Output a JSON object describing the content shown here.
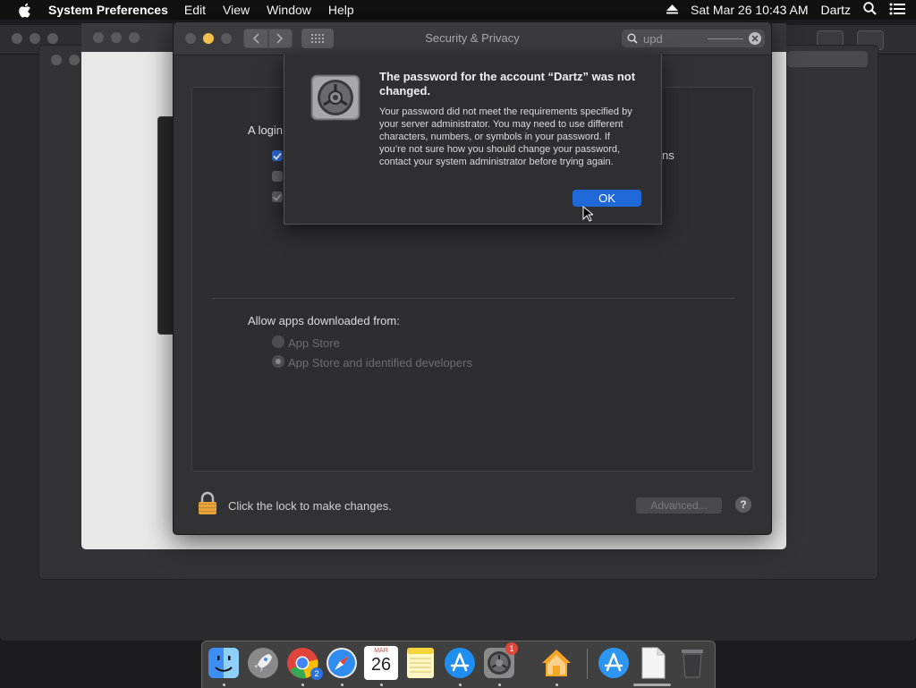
{
  "menubar": {
    "app_name": "System Preferences",
    "items": [
      "Edit",
      "View",
      "Window",
      "Help"
    ],
    "clock": "Sat Mar 26  10:43 AM",
    "user": "Dartz"
  },
  "window": {
    "title": "Security & Privacy",
    "search_value": "upd",
    "login_label": "A login",
    "ns_fragment": "ns",
    "allow_label": "Allow apps downloaded from:",
    "radio_options": [
      "App Store",
      "App Store and identified developers"
    ],
    "selected_radio": "App Store and identified developers",
    "lock_text": "Click the lock to make changes.",
    "advanced_label": "Advanced...",
    "help_label": "?"
  },
  "alert": {
    "title": "The password for the account “Dartz” was not changed.",
    "message": "Your password did not meet the requirements specified by your server administrator. You may need to use different characters, numbers, or symbols in your password. If you’re not sure how you should change your password, contact your system administrator before trying again.",
    "ok_label": "OK"
  },
  "dock": {
    "apps": [
      "Finder",
      "Launchpad",
      "Google Chrome",
      "Safari",
      "Calendar",
      "Notes",
      "App Store",
      "System Preferences",
      "Home",
      "Applications",
      "Document",
      "Trash"
    ],
    "calendar_month": "MAR",
    "calendar_day": "26",
    "chrome_badge": "2",
    "sysprefs_badge": "1"
  },
  "colors": {
    "accent": "#1e68d8",
    "window_bg": "#323234",
    "menubar_bg": "#111111"
  }
}
